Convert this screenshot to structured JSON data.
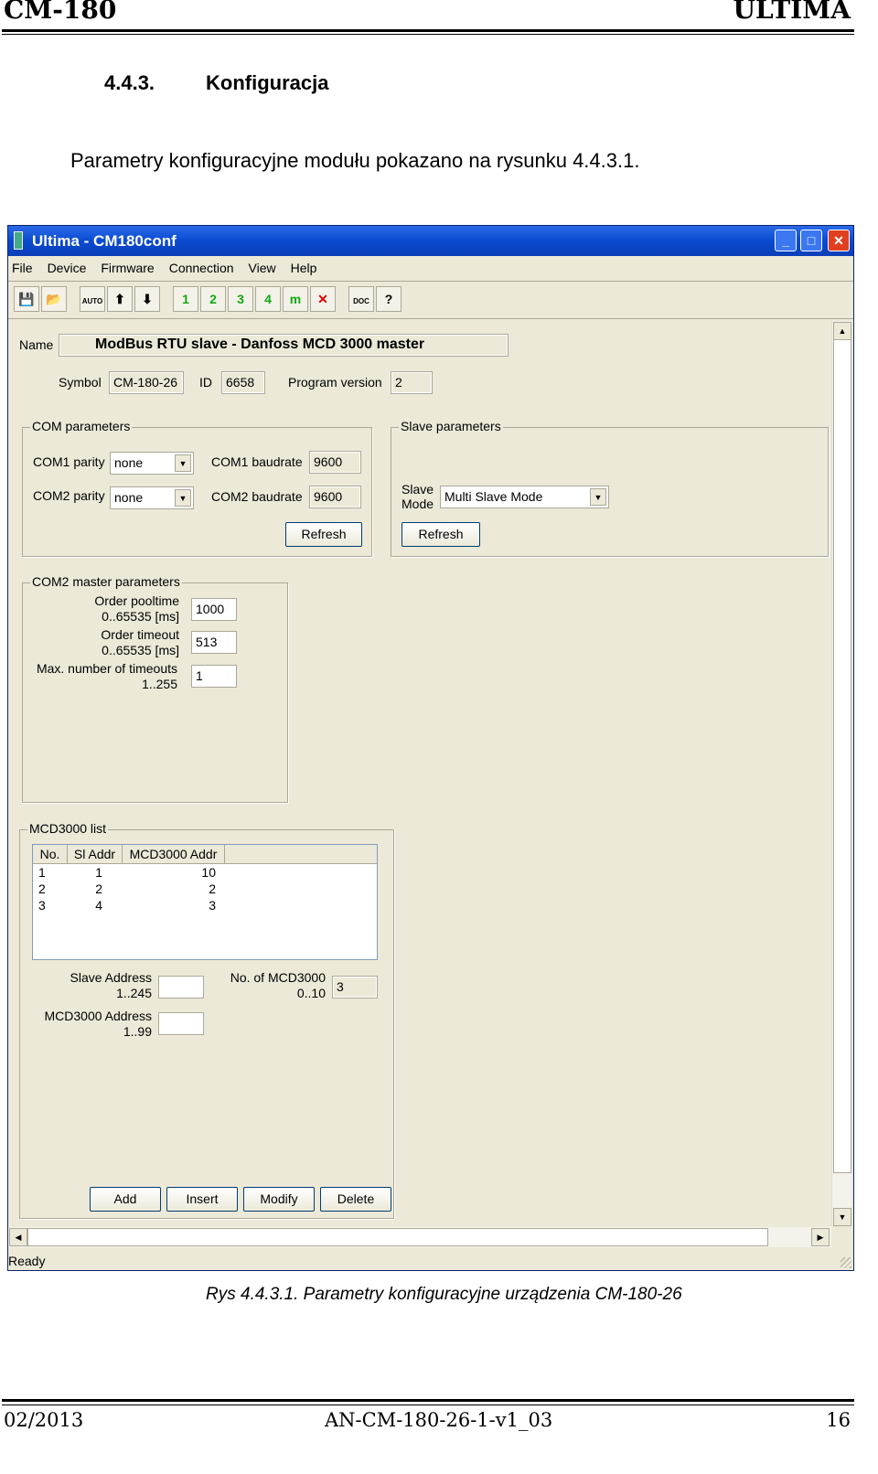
{
  "header": {
    "left": "CM-180",
    "right": "ULTIMA"
  },
  "section": {
    "number": "4.4.3.",
    "title": "Konfiguracja"
  },
  "intro": "Parametry konfiguracyjne modułu pokazano na rysunku 4.4.3.1.",
  "window": {
    "title": "Ultima - CM180conf",
    "menu": [
      "File",
      "Device",
      "Firmware",
      "Connection",
      "View",
      "Help"
    ],
    "toolbar": [
      {
        "icon": "save-icon",
        "glyph": "💾"
      },
      {
        "icon": "open-icon",
        "glyph": "📂"
      },
      {
        "icon": "auto-icon",
        "glyph": "AUTO"
      },
      {
        "icon": "upload-icon",
        "glyph": "⬆"
      },
      {
        "icon": "download-icon",
        "glyph": "⬇"
      },
      {
        "icon": "connect-1-icon",
        "glyph": "1"
      },
      {
        "icon": "connect-2-icon",
        "glyph": "2"
      },
      {
        "icon": "connect-3-icon",
        "glyph": "3"
      },
      {
        "icon": "connect-4-icon",
        "glyph": "4"
      },
      {
        "icon": "connect-m-icon",
        "glyph": "m"
      },
      {
        "icon": "disconnect-icon",
        "glyph": "✕"
      },
      {
        "icon": "doc-icon",
        "glyph": "DOC"
      },
      {
        "icon": "help-icon",
        "glyph": "?"
      }
    ],
    "name_label": "Name",
    "name_value": "ModBus RTU slave - Danfoss MCD 3000 master",
    "symbol_label": "Symbol",
    "symbol_value": "CM-180-26",
    "id_label": "ID",
    "id_value": "6658",
    "program_version_label": "Program version",
    "program_version_value": "2",
    "com": {
      "caption": "COM parameters",
      "com1_parity_label": "COM1 parity",
      "com1_parity": "none",
      "com2_parity_label": "COM2 parity",
      "com2_parity": "none",
      "com1_baud_label": "COM1 baudrate",
      "com1_baud": "9600",
      "com2_baud_label": "COM2 baudrate",
      "com2_baud": "9600",
      "refresh": "Refresh"
    },
    "slave": {
      "caption": "Slave parameters",
      "mode_label_1": "Slave",
      "mode_label_2": "Mode",
      "mode": "Multi Slave Mode",
      "refresh": "Refresh"
    },
    "master": {
      "caption": "COM2 master parameters",
      "pool_1": "Order pooltime",
      "pool_2": "0..65535 [ms]",
      "pool": "1000",
      "timeout_1": "Order timeout",
      "timeout_2": "0..65535 [ms]",
      "timeout": "513",
      "max_1": "Max. number of timeouts",
      "max_2": "1..255",
      "max": "1"
    },
    "list": {
      "caption": "MCD3000 list",
      "columns": [
        "No.",
        "Sl Addr",
        "MCD3000 Addr"
      ],
      "rows": [
        [
          "1",
          "1",
          "10"
        ],
        [
          "2",
          "2",
          "2"
        ],
        [
          "3",
          "4",
          "3"
        ]
      ],
      "slave_addr_1": "Slave Address",
      "slave_addr_2": "1..245",
      "slave_addr": "",
      "mcd_addr_1": "MCD3000 Address",
      "mcd_addr_2": "1..99",
      "mcd_addr": "",
      "count_1": "No. of MCD3000",
      "count_2": "0..10",
      "count": "3",
      "buttons": [
        "Add",
        "Insert",
        "Modify",
        "Delete"
      ]
    },
    "status": "Ready"
  },
  "caption": "Rys 4.4.3.1. Parametry konfiguracyjne urządzenia CM-180-26",
  "footer": {
    "left": "02/2013",
    "center": "AN-CM-180-26-1-v1_03",
    "right": "16"
  }
}
